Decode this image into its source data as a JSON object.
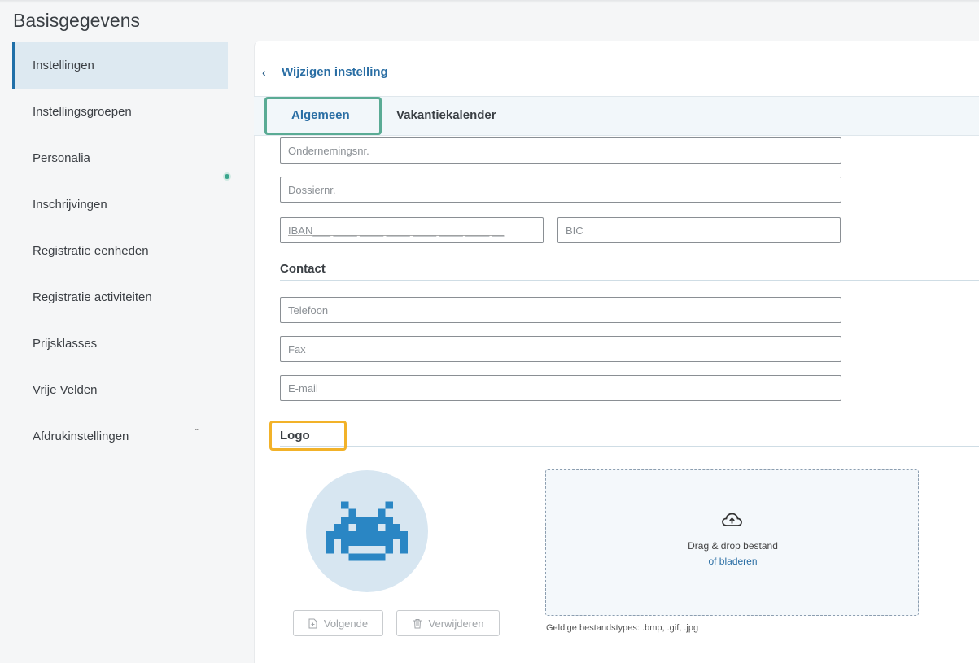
{
  "page_title": "Basisgegevens",
  "sidebar": {
    "items": [
      {
        "label": "Instellingen",
        "active": true
      },
      {
        "label": "Instellingsgroepen"
      },
      {
        "label": "Personalia"
      },
      {
        "label": "Inschrijvingen"
      },
      {
        "label": "Registratie eenheden"
      },
      {
        "label": "Registratie activiteiten"
      },
      {
        "label": "Prijsklasses"
      },
      {
        "label": "Vrije Velden"
      },
      {
        "label": "Afdrukinstellingen",
        "has_chevron": true
      }
    ]
  },
  "header": {
    "back_icon": "chevron-left-icon",
    "title": "Wijzigen instelling"
  },
  "tabs": [
    {
      "label": "Algemeen",
      "active": true
    },
    {
      "label": "Vakantiekalender"
    }
  ],
  "form": {
    "ondernemingsnr_placeholder": "Ondernemingsnr.",
    "dossiernr_placeholder": "Dossiernr.",
    "iban_placeholder": "IBAN",
    "iban_mask": "___ ____ ____ ____ ____ ____ ____ __",
    "bic_placeholder": "BIC",
    "contact_title": "Contact",
    "telefoon_placeholder": "Telefoon",
    "fax_placeholder": "Fax",
    "email_placeholder": "E-mail",
    "logo_title": "Logo"
  },
  "logo": {
    "avatar_icon": "space-invader-icon",
    "next_button": "Volgende",
    "delete_button": "Verwijderen",
    "dropzone_text": "Drag & drop bestand",
    "dropzone_link": "of bladeren",
    "valid_types": "Geldige bestandstypes: .bmp, .gif, .jpg"
  },
  "colors": {
    "accent": "#2a6ea4",
    "highlight_green": "#5aab94",
    "highlight_orange": "#f2b229"
  }
}
